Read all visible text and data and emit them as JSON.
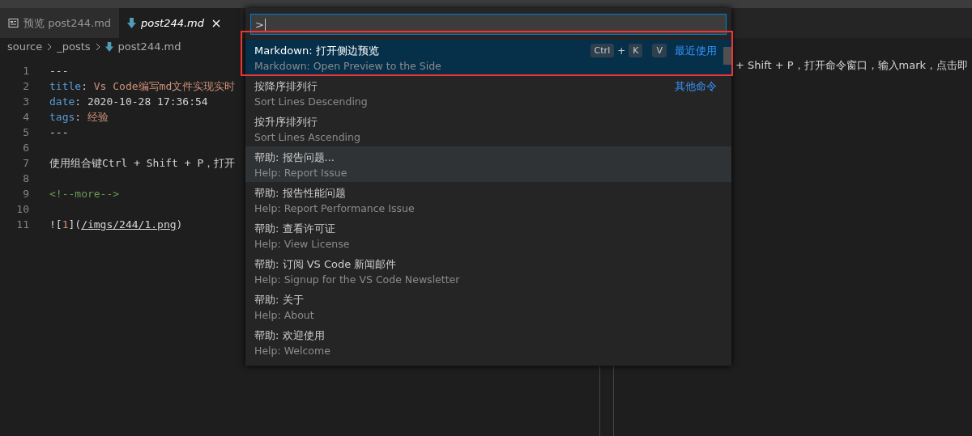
{
  "tabs": [
    {
      "label": "预览 post244.md",
      "kind": "preview",
      "selected": false
    },
    {
      "label": "post244.md",
      "kind": "markdown",
      "selected": true
    }
  ],
  "breadcrumb": [
    "source",
    "_posts",
    "post244.md"
  ],
  "editor": {
    "lines": [
      {
        "number": "1",
        "tokens": [
          {
            "text": "---",
            "kind": "plain"
          }
        ]
      },
      {
        "number": "2",
        "tokens": [
          {
            "text": "title",
            "kind": "key"
          },
          {
            "text": ": ",
            "kind": "plain"
          },
          {
            "text": "Vs Code编写md文件实现实时",
            "kind": "string"
          }
        ]
      },
      {
        "number": "3",
        "tokens": [
          {
            "text": "date",
            "kind": "key"
          },
          {
            "text": ": 2020-10-28 17:36:54",
            "kind": "plain"
          }
        ]
      },
      {
        "number": "4",
        "tokens": [
          {
            "text": "tags",
            "kind": "key"
          },
          {
            "text": ": ",
            "kind": "plain"
          },
          {
            "text": "经验",
            "kind": "string"
          }
        ]
      },
      {
        "number": "5",
        "tokens": [
          {
            "text": "---",
            "kind": "plain"
          }
        ]
      },
      {
        "number": "6"
      },
      {
        "number": "7",
        "tokens": [
          {
            "text": "使用组合键Ctrl + Shift + P，打开",
            "kind": "plain"
          }
        ]
      },
      {
        "number": "8"
      },
      {
        "number": "9",
        "tokens": [
          {
            "text": "<!--more-->",
            "kind": "comment"
          }
        ]
      },
      {
        "number": "10"
      },
      {
        "number": "11",
        "tokens": [
          {
            "text": "![",
            "kind": "plain"
          },
          {
            "text": "1",
            "kind": "string"
          },
          {
            "text": "](",
            "kind": "plain"
          },
          {
            "text": "/imgs/244/1.png",
            "kind": "link"
          },
          {
            "text": ")",
            "kind": "plain"
          }
        ]
      }
    ]
  },
  "preview": {
    "text": "+ Shift + P，打开命令窗口，输入mark，点击即"
  },
  "command_palette": {
    "value": ">",
    "items": [
      {
        "label": "Markdown: 打开侧边预览",
        "detail": "Markdown: Open Preview to the Side",
        "keys": [
          {
            "text": "Ctrl",
            "kind": "key"
          },
          {
            "text": "+",
            "kind": "sep"
          },
          {
            "text": "K",
            "kind": "key"
          },
          {
            "text": "V",
            "kind": "chord"
          }
        ],
        "group": "最近使用",
        "selected": true,
        "hovered": false
      },
      {
        "label": "按降序排列行",
        "detail": "Sort Lines Descending",
        "group": "其他命令",
        "selected": false,
        "hovered": false
      },
      {
        "label": "按升序排列行",
        "detail": "Sort Lines Ascending",
        "selected": false,
        "hovered": false
      },
      {
        "label": "帮助: 报告问题...",
        "detail": "Help: Report Issue",
        "selected": false,
        "hovered": true
      },
      {
        "label": "帮助: 报告性能问题",
        "detail": "Help: Report Performance Issue",
        "selected": false,
        "hovered": false
      },
      {
        "label": "帮助: 查看许可证",
        "detail": "Help: View License",
        "selected": false,
        "hovered": false
      },
      {
        "label": "帮助: 订阅 VS Code 新闻邮件",
        "detail": "Help: Signup for the VS Code Newsletter",
        "selected": false,
        "hovered": false
      },
      {
        "label": "帮助: 关于",
        "detail": "Help: About",
        "selected": false,
        "hovered": false
      },
      {
        "label": "帮助: 欢迎使用",
        "detail": "Help: Welcome",
        "selected": false,
        "hovered": false
      }
    ]
  }
}
